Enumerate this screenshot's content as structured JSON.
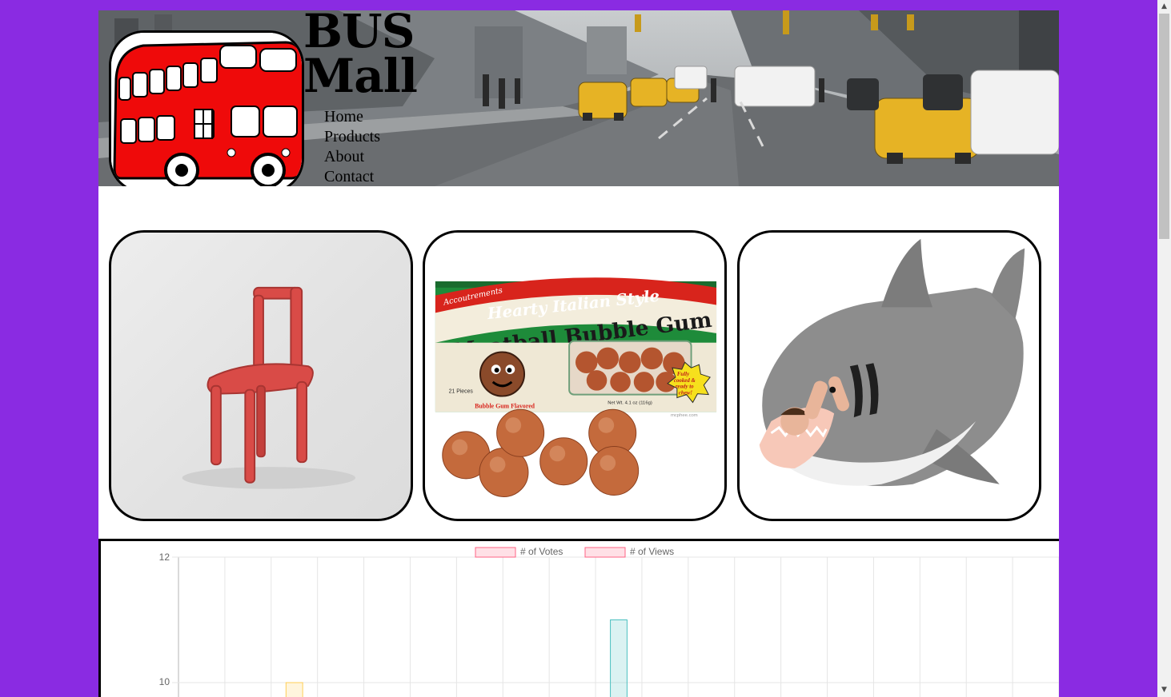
{
  "site": {
    "title_line1": "BUS",
    "title_line2": "Mall"
  },
  "nav": {
    "items": [
      "Home",
      "Products",
      "About",
      "Contact"
    ]
  },
  "products": [
    {
      "name": "chair"
    },
    {
      "name": "bubblegum",
      "package_brand": "Accoutrements",
      "package_line1": "Hearty Italian Style",
      "package_line2": "Meatball Bubble Gum",
      "package_pieces": "21 Pieces",
      "package_flavor": "Bubble Gum Flavored",
      "package_weight": "Net Wt. 4.1 oz (116g)",
      "package_burst": [
        "Fully",
        "cooked &",
        "ready to",
        "chew!"
      ],
      "package_credit": "mcphee.com"
    },
    {
      "name": "shark"
    }
  ],
  "colors": {
    "background": "#8a2be2",
    "votes_fill": "rgba(255,99,132,0.2)",
    "votes_border": "rgba(255,99,132,1)",
    "bar_yellow_fill": "rgba(255,206,86,0.2)",
    "bar_yellow_border": "rgba(255,206,86,1)",
    "bar_teal_fill": "rgba(75,192,192,0.2)",
    "bar_teal_border": "rgba(75,192,192,1)"
  },
  "chart_data": {
    "type": "bar",
    "legend": [
      "# of Votes",
      "# of Views"
    ],
    "legend_position": "top",
    "grid": true,
    "y_ticks": [
      "12",
      "10"
    ],
    "ylim_visible": [
      9.75,
      12
    ],
    "category_count": 19,
    "visible_bars": [
      {
        "category_index": 2,
        "value": 10,
        "color": "yellow"
      },
      {
        "category_index": 9,
        "value": 11,
        "color": "teal"
      }
    ]
  }
}
